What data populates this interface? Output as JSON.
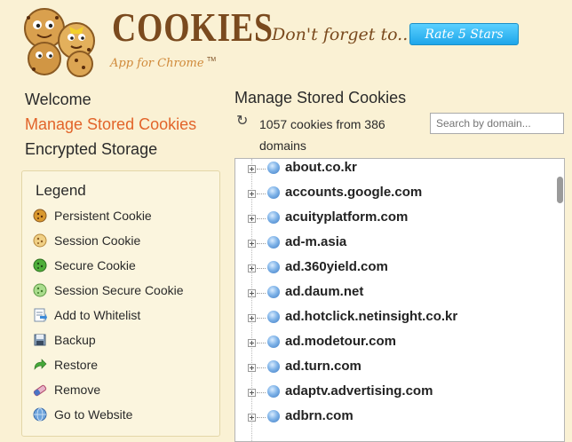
{
  "header": {
    "brand": "COOKIES",
    "tagline": "App for Chrome",
    "tm": "TM",
    "reminder": "Don't forget to...",
    "rate_label": "Rate 5 Stars"
  },
  "nav": {
    "items": [
      "Welcome",
      "Manage Stored Cookies",
      "Encrypted Storage"
    ],
    "active": "Manage Stored Cookies"
  },
  "legend": {
    "title": "Legend",
    "items": [
      {
        "icon": "persistent-cookie-icon",
        "label": "Persistent Cookie"
      },
      {
        "icon": "session-cookie-icon",
        "label": "Session Cookie"
      },
      {
        "icon": "secure-cookie-icon",
        "label": "Secure Cookie"
      },
      {
        "icon": "session-secure-cookie-icon",
        "label": "Session Secure Cookie"
      },
      {
        "icon": "add-whitelist-icon",
        "label": "Add to Whitelist"
      },
      {
        "icon": "backup-icon",
        "label": "Backup"
      },
      {
        "icon": "restore-icon",
        "label": "Restore"
      },
      {
        "icon": "remove-icon",
        "label": "Remove"
      },
      {
        "icon": "globe-icon",
        "label": "Go to Website"
      }
    ]
  },
  "main": {
    "title": "Manage Stored Cookies",
    "count_text": "1057 cookies from 386 domains",
    "search_placeholder": "Search by domain..."
  },
  "domains": [
    "about.co.kr",
    "accounts.google.com",
    "acuityplatform.com",
    "ad-m.asia",
    "ad.360yield.com",
    "ad.daum.net",
    "ad.hotclick.netinsight.co.kr",
    "ad.modetour.com",
    "ad.turn.com",
    "adaptv.advertising.com",
    "adbrn.com"
  ],
  "colors": {
    "background": "#faf1d4",
    "accent": "#e2642a",
    "rate_button": "#1ea6ea",
    "brand": "#7a4a1e"
  }
}
